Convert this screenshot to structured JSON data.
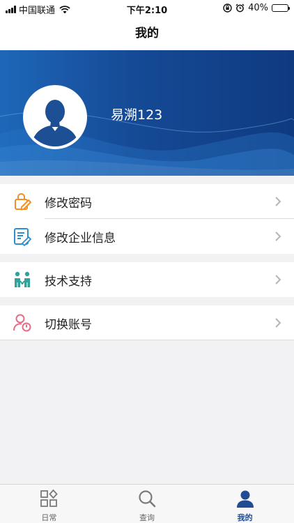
{
  "statusbar": {
    "carrier": "中国联通",
    "time": "下午2:10",
    "battery": "40%",
    "battery_level": 0.4
  },
  "navbar": {
    "title": "我的"
  },
  "profile": {
    "username": "易溯123"
  },
  "menu": {
    "group1": [
      {
        "label": "修改密码",
        "icon": "lock-edit-icon"
      },
      {
        "label": "修改企业信息",
        "icon": "document-edit-icon"
      }
    ],
    "group2": [
      {
        "label": "技术支持",
        "icon": "support-people-icon"
      }
    ],
    "group3": [
      {
        "label": "切换账号",
        "icon": "user-switch-icon"
      }
    ]
  },
  "tabbar": {
    "tabs": [
      {
        "label": "日常",
        "icon": "grid-icon",
        "active": false
      },
      {
        "label": "查询",
        "icon": "search-icon",
        "active": false
      },
      {
        "label": "我的",
        "icon": "person-icon",
        "active": true
      }
    ]
  },
  "colors": {
    "accent": "#1f4d93",
    "orange": "#f0902a",
    "teal": "#2ea39a",
    "pink": "#e56d85",
    "banner_dark": "#0f3a80"
  }
}
